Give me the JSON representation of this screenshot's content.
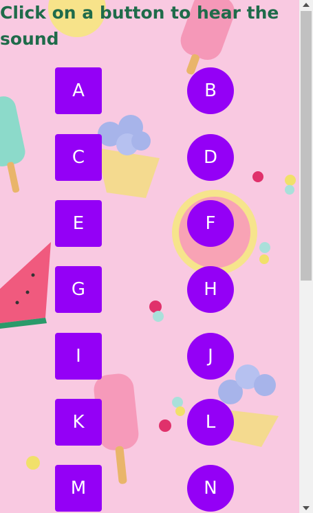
{
  "title": "Click on a button to hear the sound",
  "colors": {
    "background": "#f9c9e1",
    "button": "#9400f6",
    "button_text": "#ffffff",
    "title_text": "#1f6b4a"
  },
  "buttons": {
    "rows": [
      {
        "square": "A",
        "round": "B"
      },
      {
        "square": "C",
        "round": "D"
      },
      {
        "square": "E",
        "round": "F"
      },
      {
        "square": "G",
        "round": "H"
      },
      {
        "square": "I",
        "round": "J"
      },
      {
        "square": "K",
        "round": "L"
      },
      {
        "square": "M",
        "round": "N"
      }
    ]
  }
}
